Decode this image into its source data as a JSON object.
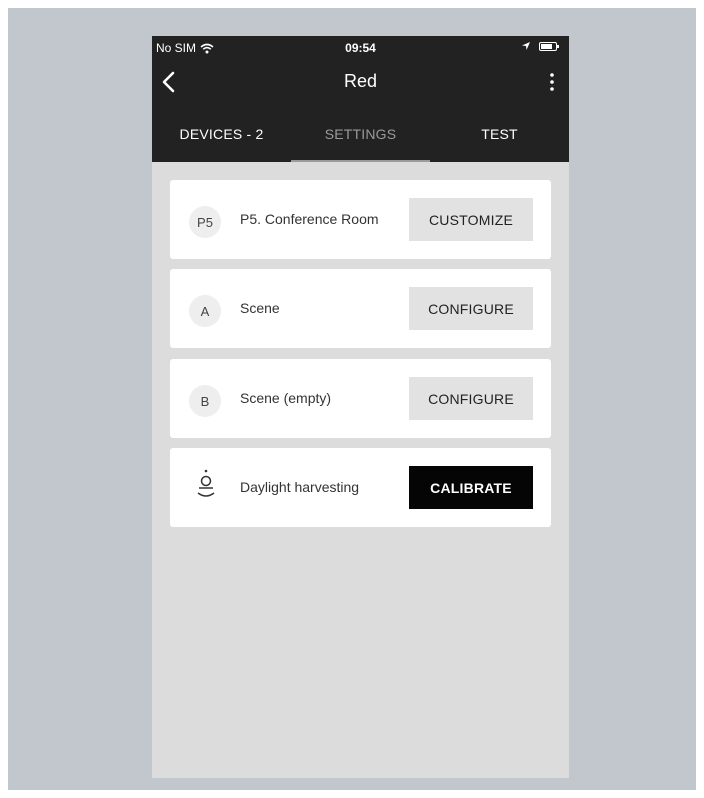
{
  "status_bar": {
    "carrier": "No SIM",
    "time": "09:54"
  },
  "navbar": {
    "title": "Red"
  },
  "tabs": [
    {
      "label": "DEVICES - 2"
    },
    {
      "label": "SETTINGS",
      "selected": true
    },
    {
      "label": "TEST"
    }
  ],
  "cards": [
    {
      "badge": "P5",
      "label": "P5. Conference Room",
      "button": "CUSTOMIZE"
    },
    {
      "badge": "A",
      "label": "Scene",
      "button": "CONFIGURE"
    },
    {
      "badge": "B",
      "label": "Scene (empty)",
      "button": "CONFIGURE"
    },
    {
      "icon": "daylight-sensor-icon",
      "label": "Daylight harvesting",
      "button": "CALIBRATE"
    }
  ],
  "colors": {
    "header_bg": "#222222",
    "content_bg": "#dcdcdc",
    "button_light": "#e2e2e2",
    "button_dark": "#050505"
  }
}
